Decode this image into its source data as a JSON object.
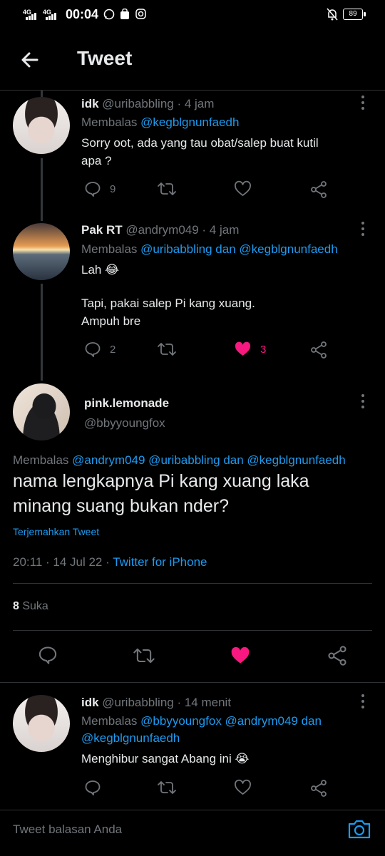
{
  "status_bar": {
    "time": "00:04",
    "net1": "4G",
    "net2": "4G",
    "battery": "89"
  },
  "header": {
    "title": "Tweet"
  },
  "replies_above": [
    {
      "name": "idk",
      "handle": "@uribabbling",
      "time": "· 4 jam",
      "replying_prefix": "Membalas",
      "replying_to": "@kegblgnunfaedh",
      "text_lines": [
        "Sorry oot, ada yang tau obat/salep buat kutil",
        "apa ?"
      ],
      "reply_count": "9"
    },
    {
      "name": "Pak RT",
      "handle": "@andrym049",
      "time": "· 4 jam",
      "replying_prefix": "Membalas",
      "replying_to": "@uribabbling dan @kegblgnunfaedh",
      "text_lines": [
        "Lah 😂",
        "Tapi, pakai salep Pi kang xuang.",
        "Ampuh bre"
      ],
      "reply_count": "2",
      "like_count": "3"
    }
  ],
  "main_tweet": {
    "name": "pink.lemonade",
    "handle": "@bbyyoungfox",
    "replying_prefix": "Membalas",
    "replying_to": "@andrym049 @uribabbling dan @kegblgnunfaedh",
    "text_lines": [
      "nama lengkapnya Pi kang xuang laka",
      "minang suang bukan nder?"
    ],
    "translate": "Terjemahkan Tweet",
    "timestamp": "20:11 · 14 Jul 22 ·",
    "source": "Twitter for iPhone",
    "likes_count": "8",
    "likes_label": "Suka"
  },
  "reply_below": {
    "name": "idk",
    "handle": "@uribabbling",
    "time": "· 14 menit",
    "replying_prefix": "Membalas",
    "replying_line1": "@bbyyoungfox @andrym049 dan",
    "replying_line2": "@kegblgnunfaedh",
    "text": "Menghibur sangat Abang ini 😭"
  },
  "composer": {
    "placeholder": "Tweet balasan Anda"
  },
  "colors": {
    "accent": "#1d9bf0",
    "like": "#f91880",
    "muted": "#71767b",
    "background": "#000000"
  }
}
